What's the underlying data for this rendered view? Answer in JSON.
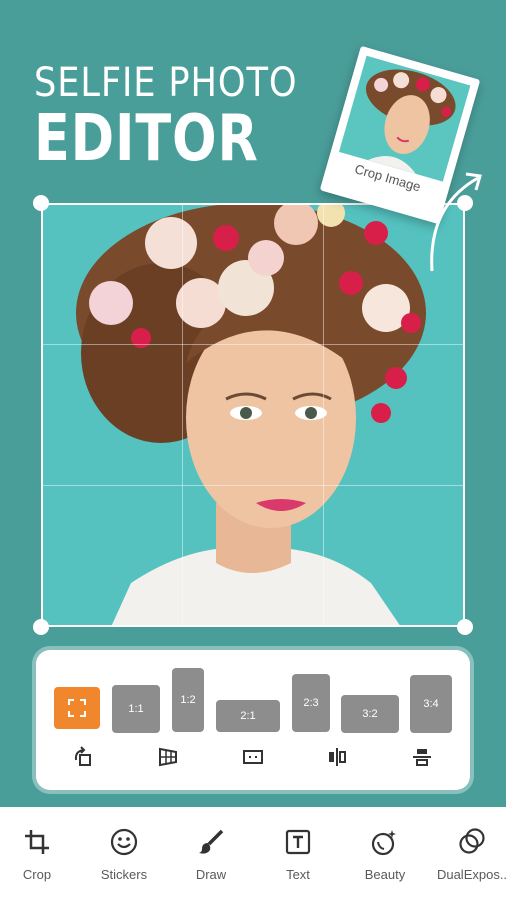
{
  "headline": {
    "line1": "SELFIE PHOTO",
    "line2": "EDITOR"
  },
  "preview_card": {
    "caption": "Crop Image"
  },
  "ratios": [
    {
      "label": ""
    },
    {
      "label": "1:1"
    },
    {
      "label": "1:2"
    },
    {
      "label": "2:1"
    },
    {
      "label": "2:3"
    },
    {
      "label": "3:2"
    },
    {
      "label": "3:4"
    }
  ],
  "tools": [
    {
      "icon": "rotate-icon"
    },
    {
      "icon": "perspective-icon"
    },
    {
      "icon": "frame-icon"
    },
    {
      "icon": "flip-horizontal-icon"
    },
    {
      "icon": "flip-vertical-icon"
    }
  ],
  "nav": [
    {
      "label": "Crop",
      "icon": "crop-icon"
    },
    {
      "label": "Stickers",
      "icon": "smiley-icon"
    },
    {
      "label": "Draw",
      "icon": "brush-icon"
    },
    {
      "label": "Text",
      "icon": "text-icon"
    },
    {
      "label": "Beauty",
      "icon": "beauty-icon"
    },
    {
      "label": "DualExpos..",
      "icon": "dual-exposure-icon"
    }
  ],
  "colors": {
    "background": "#4a9e9a",
    "photo_bg": "#55c2bf",
    "accent": "#f0872c",
    "ratio_gray": "#8d8d8d"
  }
}
